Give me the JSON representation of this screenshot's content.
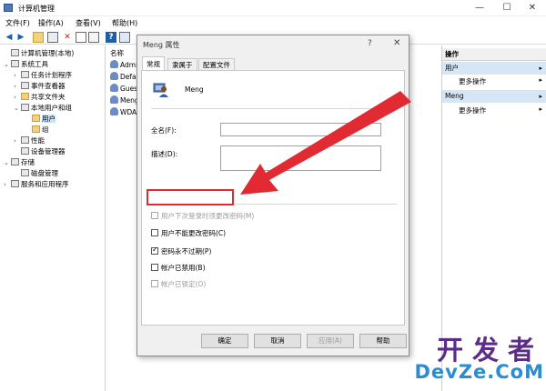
{
  "window": {
    "title": "计算机管理",
    "minimize": "—",
    "maximize": "☐",
    "close": "✕"
  },
  "menu": [
    "文件(F)",
    "操作(A)",
    "查看(V)",
    "帮助(H)"
  ],
  "toolbar_icons": [
    "back-icon",
    "forward-icon",
    "folder-up-icon",
    "properties-icon",
    "delete-icon",
    "export-icon",
    "refresh-icon",
    "help-icon",
    "view-icon"
  ],
  "tree": [
    {
      "label": "计算机管理(本地)",
      "expander": "",
      "icon": "computer",
      "indent": 0
    },
    {
      "label": "系统工具",
      "expander": "⌄",
      "icon": "tool",
      "indent": 1
    },
    {
      "label": "任务计划程序",
      "expander": "›",
      "icon": "task",
      "indent": 2
    },
    {
      "label": "事件查看器",
      "expander": "›",
      "icon": "event",
      "indent": 2
    },
    {
      "label": "共享文件夹",
      "expander": "›",
      "icon": "folder",
      "indent": 2
    },
    {
      "label": "本地用户和组",
      "expander": "⌄",
      "icon": "users",
      "indent": 2
    },
    {
      "label": "用户",
      "expander": "",
      "icon": "folder",
      "indent": 3,
      "selected": true
    },
    {
      "label": "组",
      "expander": "",
      "icon": "folder",
      "indent": 3
    },
    {
      "label": "性能",
      "expander": "›",
      "icon": "perf",
      "indent": 2
    },
    {
      "label": "设备管理器",
      "expander": "",
      "icon": "device",
      "indent": 2
    },
    {
      "label": "存储",
      "expander": "⌄",
      "icon": "storage",
      "indent": 1
    },
    {
      "label": "磁盘管理",
      "expander": "",
      "icon": "disk",
      "indent": 2
    },
    {
      "label": "服务和应用程序",
      "expander": "›",
      "icon": "services",
      "indent": 1
    }
  ],
  "list": {
    "header": "名称",
    "rows": [
      "Admi",
      "Defa",
      "Gues",
      "Meng",
      "WDA"
    ]
  },
  "actions": {
    "header": "操作",
    "sections": [
      {
        "title": "用户",
        "item": "更多操作"
      },
      {
        "title": "Meng",
        "item": "更多操作"
      }
    ],
    "arrow": "▸"
  },
  "dialog": {
    "title": "Meng 属性",
    "help": "?",
    "close": "✕",
    "tabs": [
      "常规",
      "隶属于",
      "配置文件"
    ],
    "username": "Meng",
    "fullname_label": "全名(F):",
    "description_label": "描述(D):",
    "fullname_value": "",
    "description_value": "",
    "checkboxes": [
      {
        "label": "用户下次登录时须更改密码(M)",
        "checked": false,
        "disabled": true
      },
      {
        "label": "用户不能更改密码(C)",
        "checked": false,
        "disabled": false
      },
      {
        "label": "密码永不过期(P)",
        "checked": true,
        "disabled": false
      },
      {
        "label": "帐户已禁用(B)",
        "checked": false,
        "disabled": false
      },
      {
        "label": "帐户已锁定(O)",
        "checked": false,
        "disabled": true
      }
    ],
    "buttons": {
      "ok": "确定",
      "cancel": "取消",
      "apply": "应用(A)",
      "help": "帮助"
    }
  },
  "watermark": {
    "cn": "开发者",
    "en": "DevZe.CoM"
  },
  "colors": {
    "annotation_red": "#e22a33",
    "selection_blue": "#cce4f7",
    "action_section": "#d6e6f5",
    "watermark_purple": "#5b2d86",
    "watermark_blue": "#2a8cd3"
  }
}
